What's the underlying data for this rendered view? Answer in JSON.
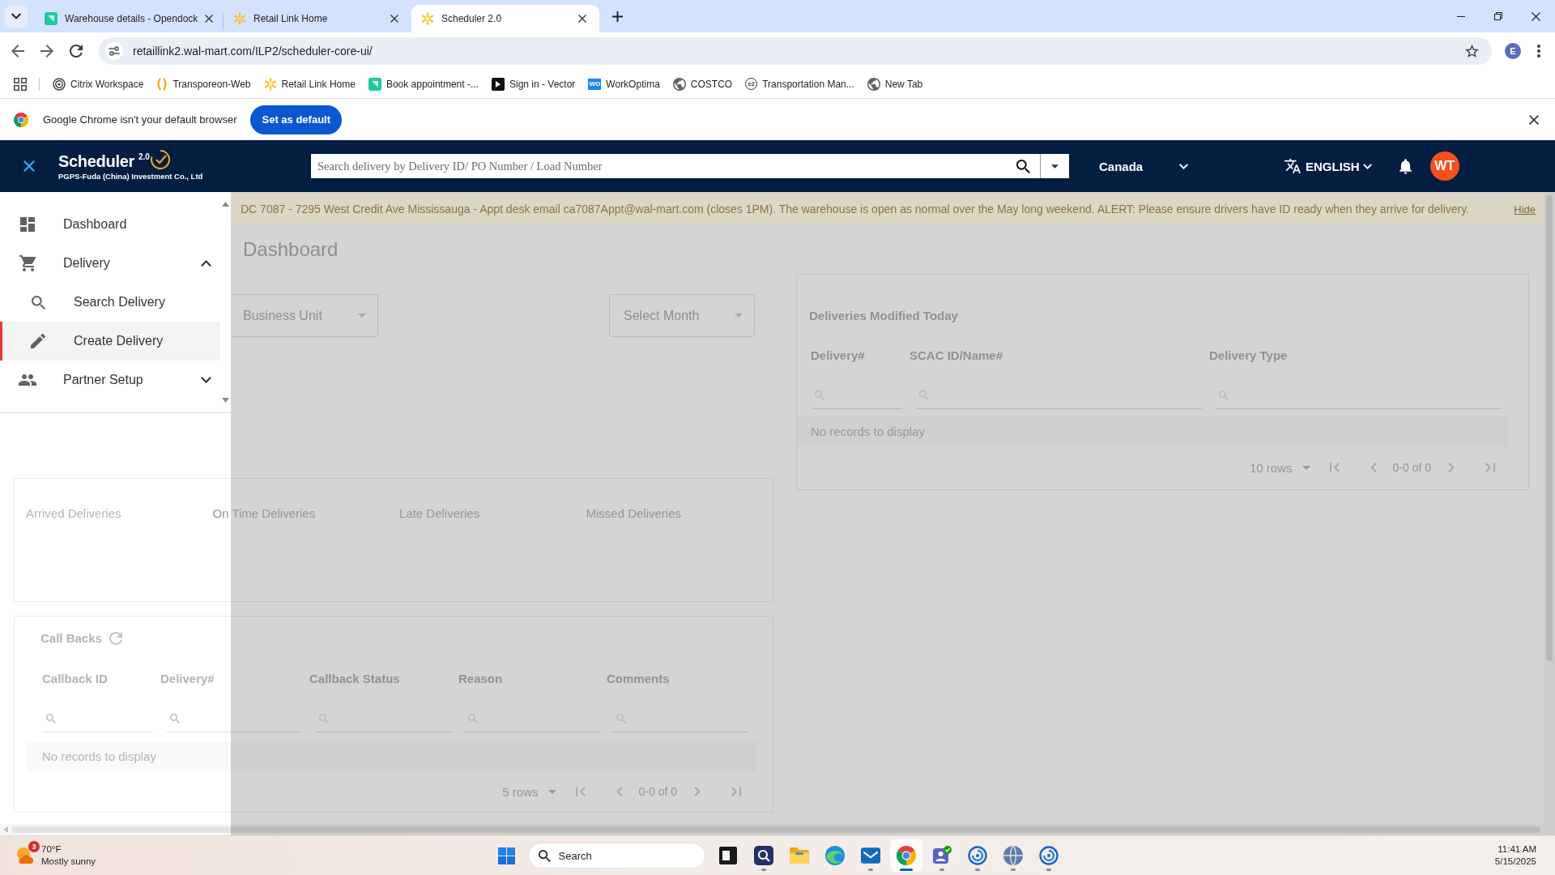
{
  "browser": {
    "tabs": [
      {
        "title": "Warehouse details - Opendock",
        "selected": false
      },
      {
        "title": "Retail Link Home",
        "selected": false
      },
      {
        "title": "Scheduler 2.0",
        "selected": true
      }
    ],
    "address": "retaillink2.wal-mart.com/ILP2/scheduler-core-ui/",
    "profile": "E",
    "bookmarks": [
      {
        "label": "Citrix Workspace"
      },
      {
        "label": "Transporeon-Web"
      },
      {
        "label": "Retail Link Home"
      },
      {
        "label": "Book appointment -..."
      },
      {
        "label": "Sign in - Vector"
      },
      {
        "label": "WorkOptima",
        "icon_text": "WO"
      },
      {
        "label": "COSTCO"
      },
      {
        "label": "Transportation Man...",
        "icon_text": "e2"
      },
      {
        "label": "New Tab"
      }
    ],
    "infobar": {
      "message": "Google Chrome isn't your default browser",
      "button": "Set as default"
    }
  },
  "header": {
    "logo": {
      "title": "Scheduler",
      "version": "2.0",
      "subtitle": "PGPS-Fuda (China) Investment Co., Ltd"
    },
    "search": {
      "placeholder": "Search delivery by Delivery ID/ PO Number / Load Number"
    },
    "country": "Canada",
    "language": "ENGLISH",
    "avatar": "WT"
  },
  "banner": {
    "message": "DC 7087 - 7295 West Credit Ave Mississauga - Appt desk email ca7087Appt@wal-mart.com (closes 1PM). The warehouse is open as normal over the May long weekend. ALERT: Please ensure drivers have ID ready when they arrive for delivery.",
    "action": "Hide"
  },
  "navigation": [
    {
      "label": "Dashboard",
      "selected": false
    },
    {
      "label": "Delivery",
      "expanded": true,
      "selected": false,
      "children": [
        {
          "label": "Search Delivery",
          "selected": false
        },
        {
          "label": "Create Delivery",
          "selected": true
        }
      ]
    },
    {
      "label": "Partner Setup",
      "expanded": false,
      "selected": false
    }
  ],
  "dashboard": {
    "title": "Dashboard",
    "filters": [
      {
        "placeholder": "Business Unit"
      },
      {
        "placeholder": "Select Month"
      }
    ],
    "modified_today": {
      "title": "Deliveries Modified Today",
      "columns": [
        "Delivery#",
        "SCAC ID/Name#",
        "Delivery Type"
      ],
      "empty_message": "No records to display",
      "rows_per_page": "10 rows",
      "range": "0-0 of 0"
    },
    "stats": [
      {
        "label": "Arrived Deliveries"
      },
      {
        "label": "On Time Deliveries"
      },
      {
        "label": "Late Deliveries"
      },
      {
        "label": "Missed Deliveries"
      }
    ],
    "callbacks": {
      "title": "Call Backs",
      "columns": [
        "Callback ID",
        "Delivery#",
        "Callback Status",
        "Reason",
        "Comments"
      ],
      "empty_message": "No records to display",
      "rows_per_page": "5 rows",
      "range": "0-0 of 0"
    }
  },
  "taskbar": {
    "weather": {
      "badge": "3",
      "temperature": "70°F",
      "condition": "Mostly sunny"
    },
    "search": {
      "placeholder": "Search"
    },
    "apps": [
      {
        "open": false,
        "selected": false
      },
      {
        "open": true,
        "selected": false
      },
      {
        "open": false,
        "selected": false
      },
      {
        "open": false,
        "selected": false
      },
      {
        "open": true,
        "selected": false
      },
      {
        "open": true,
        "selected": true
      },
      {
        "open": true,
        "selected": false
      },
      {
        "open": true,
        "selected": false
      },
      {
        "open": true,
        "selected": false
      },
      {
        "open": true,
        "selected": false
      }
    ],
    "time": "11:41 AM",
    "date": "5/15/2025"
  }
}
